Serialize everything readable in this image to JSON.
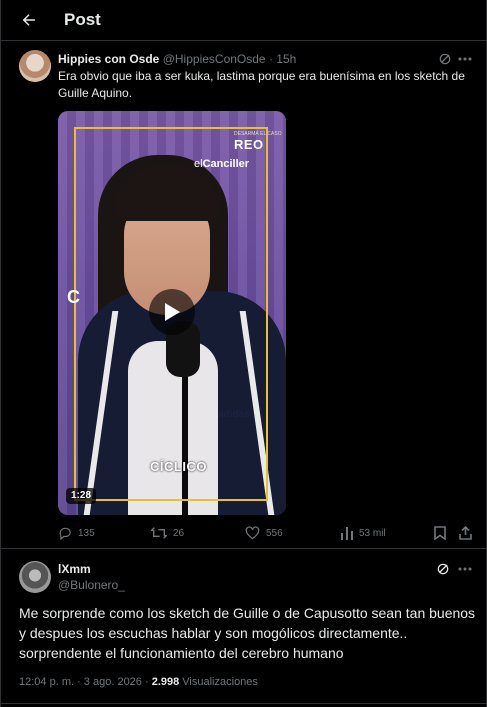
{
  "header": {
    "title": "Post"
  },
  "quoted_tweet": {
    "author_name": "Hippies con Osde",
    "author_handle": "@HippiesConOsde",
    "time": "· 15h",
    "text": "Era obvio que iba a ser kuka, lastima porque era buenísima en los sketch de Guille Aquino.",
    "video": {
      "duration": "1:28",
      "overlay_brand": "REO",
      "overlay_brand_small": "DESARMÁ EL CASO",
      "overlay_canciller_prefix": "el",
      "overlay_canciller": "Canciller",
      "overlay_c": "C",
      "overlay_ciclico": "CÍCLICO",
      "overlay_adidas": "adidas"
    },
    "stats": {
      "replies": "135",
      "reposts": "26",
      "likes": "556",
      "views": "53 mil"
    }
  },
  "main_tweet": {
    "author_name": "lXmm",
    "author_handle": "@Bulonero_",
    "text": "Me sorprende como los sketch de Guille o de Capusotto sean tan buenos y despues los escuchas hablar y son mogólicos directamente.. sorprendente el funcionamiento del cerebro humano",
    "time": "12:04 p. m. · 3 ago. 2026 ·",
    "views_count": "2.998",
    "views_label": "Visualizaciones"
  },
  "colors": {
    "background": "#000000",
    "text": "#e7e9ea",
    "muted": "#71767b",
    "divider": "#2f3336",
    "video_frame": "#e5c229"
  }
}
